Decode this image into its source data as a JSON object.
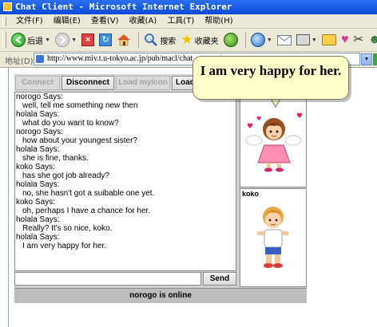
{
  "window": {
    "title": "Chat Client - Microsoft Internet Explorer"
  },
  "menu": {
    "items": [
      "文件(F)",
      "编辑(E)",
      "查看(V)",
      "收藏(A)",
      "工具(T)",
      "帮助(H)"
    ]
  },
  "toolbar": {
    "back_label": "后退",
    "search_label": "搜索",
    "favorites_label": "收藏夹"
  },
  "address": {
    "label": "地址(D)",
    "url": "http://www.miv.t.u-tokyo.ac.jp/pub/macl/chat_system/"
  },
  "applet": {
    "buttons": {
      "connect": "Connect",
      "disconnect": "Disconnect",
      "load_icon": "Load myIcon",
      "load_other": "Load O"
    },
    "messages": [
      {
        "who": "norogo Says:",
        "text": "well, tell me something new then"
      },
      {
        "who": "holala Says:",
        "text": "what do you want to know?"
      },
      {
        "who": "norogo Says:",
        "text": "how about your youngest sister?"
      },
      {
        "who": "holala Says:",
        "text": "she is fine, thanks."
      },
      {
        "who": "koko Says:",
        "text": "has she got job already?"
      },
      {
        "who": "holala Says:",
        "text": "no, she hasn't got a suibable one yet."
      },
      {
        "who": "koko Says:",
        "text": "oh, perhaps I have a chance for her."
      },
      {
        "who": "holala Says:",
        "text": "Really? It's so nice, koko."
      },
      {
        "who": "holala Says:",
        "text": "I am very happy for her."
      }
    ],
    "input": {
      "value": "",
      "placeholder": ""
    },
    "send_label": "Send",
    "avatars": [
      {
        "name": "",
        "icon": "angel-girl-icon"
      },
      {
        "name": "koko",
        "icon": "boy-icon"
      }
    ],
    "status": "norogo is online",
    "bubble_text": "I am very happy for her."
  },
  "colors": {
    "titlebar": "#0a4ad6",
    "bubble": "#ffffcc",
    "panel": "#cfcfcf",
    "status_bar": "#bdbdbd"
  }
}
